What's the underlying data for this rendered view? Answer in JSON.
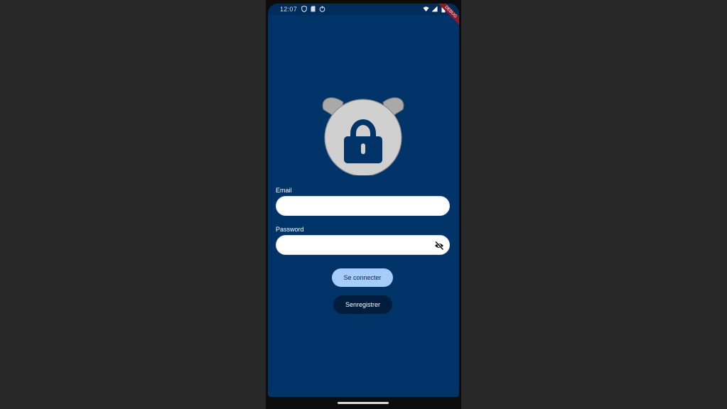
{
  "status_bar": {
    "time": "12:07",
    "left_icons": [
      "shield-icon",
      "sd-card-icon",
      "power-icon"
    ],
    "right_icons": [
      "wifi-icon",
      "signal-icon",
      "battery-icon"
    ]
  },
  "debug_banner": "DEBUG",
  "logo": {
    "icon": "lock-icon",
    "circle_color": "#d0d0d0",
    "ear_color": "#a9a9a9",
    "lock_color": "#003468"
  },
  "form": {
    "email_label": "Email",
    "email_value": "",
    "password_label": "Password",
    "password_value": "",
    "visibility_icon": "eye-off-icon"
  },
  "buttons": {
    "login_label": "Se connecter",
    "register_label": "Senregistrer"
  },
  "colors": {
    "background": "#003468",
    "login_button": "#a6ccfa",
    "register_button": "#001d3d"
  }
}
